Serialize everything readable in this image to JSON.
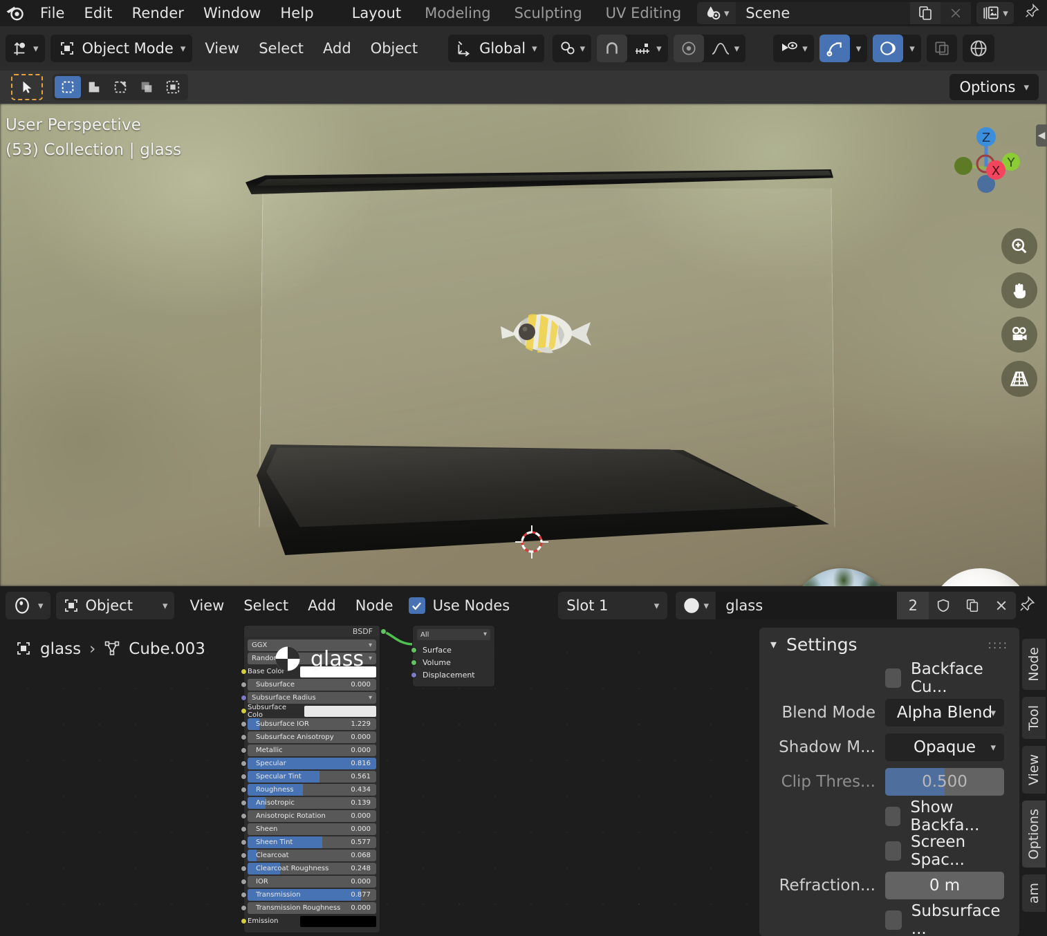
{
  "app": {
    "menus": [
      "File",
      "Edit",
      "Render",
      "Window",
      "Help"
    ],
    "workspaces": [
      {
        "label": "Layout",
        "active": true
      },
      {
        "label": "Modeling",
        "active": false
      },
      {
        "label": "Sculpting",
        "active": false
      },
      {
        "label": "UV Editing",
        "active": false
      }
    ],
    "scene_name": "Scene"
  },
  "toolbar": {
    "mode": "Object Mode",
    "menus": [
      "View",
      "Select",
      "Add",
      "Object"
    ],
    "transform_orientation": "Global"
  },
  "toolheader": {
    "options_label": "Options"
  },
  "viewport": {
    "line1": "User Perspective",
    "line2": "(53) Collection | glass",
    "gizmo_axes": [
      "Z",
      "X",
      "Y"
    ]
  },
  "shader_header": {
    "editor_type": "shader-editor-icon",
    "shader_type": "Object",
    "menus": [
      "View",
      "Select",
      "Add",
      "Node"
    ],
    "use_nodes_label": "Use Nodes",
    "use_nodes_checked": true,
    "slot": "Slot 1",
    "material_name": "glass",
    "material_users": "2",
    "buttons": [
      "shield-fake-user",
      "new-material-copy",
      "unlink-material"
    ]
  },
  "node_editor": {
    "breadcrumb": [
      "glass",
      "Cube.003"
    ],
    "preview_label": "glass",
    "bsdf_node": {
      "output_label": "BSDF",
      "distribution": "GGX",
      "subsurface_method": "Random Walk",
      "sockets": [
        {
          "name": "Base Color",
          "type": "color",
          "value": "#ffffff",
          "socket": "yellow"
        },
        {
          "name": "Subsurface",
          "type": "slider",
          "value": "0.000",
          "fill": 0,
          "socket": "gray"
        },
        {
          "name": "Subsurface Radius",
          "type": "dropdown",
          "value": "",
          "socket": "purple"
        },
        {
          "name": "Subsurface Colo",
          "type": "color",
          "value": "#e8e8e8",
          "socket": "yellow"
        },
        {
          "name": "Subsurface IOR",
          "type": "slider",
          "value": "1.229",
          "fill": 9,
          "socket": "gray"
        },
        {
          "name": "Subsurface Anisotropy",
          "type": "slider",
          "value": "0.000",
          "fill": 0,
          "socket": "gray"
        },
        {
          "name": "Metallic",
          "type": "slider",
          "value": "0.000",
          "fill": 0,
          "socket": "gray"
        },
        {
          "name": "Specular",
          "type": "slider",
          "value": "0.816",
          "fill": 100,
          "socket": "gray"
        },
        {
          "name": "Specular Tint",
          "type": "slider",
          "value": "0.561",
          "fill": 56,
          "socket": "gray"
        },
        {
          "name": "Roughness",
          "type": "slider",
          "value": "0.434",
          "fill": 43,
          "socket": "gray"
        },
        {
          "name": "Anisotropic",
          "type": "slider",
          "value": "0.139",
          "fill": 14,
          "socket": "gray"
        },
        {
          "name": "Anisotropic Rotation",
          "type": "slider",
          "value": "0.000",
          "fill": 0,
          "socket": "gray"
        },
        {
          "name": "Sheen",
          "type": "slider",
          "value": "0.000",
          "fill": 0,
          "socket": "gray"
        },
        {
          "name": "Sheen Tint",
          "type": "slider",
          "value": "0.577",
          "fill": 58,
          "socket": "gray"
        },
        {
          "name": "Clearcoat",
          "type": "slider",
          "value": "0.068",
          "fill": 7,
          "socket": "gray"
        },
        {
          "name": "Clearcoat Roughness",
          "type": "slider",
          "value": "0.248",
          "fill": 25,
          "socket": "gray"
        },
        {
          "name": "IOR",
          "type": "slider",
          "value": "0.000",
          "fill": 0,
          "socket": "gray"
        },
        {
          "name": "Transmission",
          "type": "slider",
          "value": "0.877",
          "fill": 88,
          "socket": "gray"
        },
        {
          "name": "Transmission Roughness",
          "type": "slider",
          "value": "0.000",
          "fill": 0,
          "socket": "gray"
        },
        {
          "name": "Emission",
          "type": "color",
          "value": "#000000",
          "socket": "yellow"
        }
      ]
    },
    "output_node": {
      "target": "All",
      "inputs": [
        {
          "name": "Surface",
          "socket": "green"
        },
        {
          "name": "Volume",
          "socket": "green"
        },
        {
          "name": "Displacement",
          "socket": "purple"
        }
      ]
    }
  },
  "sidebar": {
    "title": "Settings",
    "rows": [
      {
        "kind": "checkbox",
        "label": "Backface Cu...",
        "checked": false
      },
      {
        "kind": "select",
        "label": "Blend Mode",
        "value": "Alpha Blend"
      },
      {
        "kind": "select",
        "label": "Shadow M...",
        "value": "Opaque"
      },
      {
        "kind": "slider",
        "label": "Clip Thres...",
        "value": "0.500",
        "fill": 50,
        "dim": true
      },
      {
        "kind": "checkbox",
        "label": "Show Backfa...",
        "checked": false
      },
      {
        "kind": "checkbox",
        "label": "Screen Spac...",
        "checked": false
      },
      {
        "kind": "number",
        "label": "Refraction...",
        "value": "0 m"
      },
      {
        "kind": "checkbox",
        "label": "Subsurface ...",
        "checked": false
      }
    ],
    "tabs": [
      {
        "label": "Node",
        "active": false
      },
      {
        "label": "Tool",
        "active": false
      },
      {
        "label": "View",
        "active": false
      },
      {
        "label": "Options",
        "active": true
      },
      {
        "label": "am",
        "active": false
      }
    ]
  },
  "colors": {
    "accent_blue": "#4772b3",
    "tool_orange": "#e8a33d",
    "socket_green": "#62c262",
    "socket_yellow": "#cfcf3e",
    "socket_purple": "#7a7ac8",
    "socket_gray": "#a1a1a1"
  }
}
